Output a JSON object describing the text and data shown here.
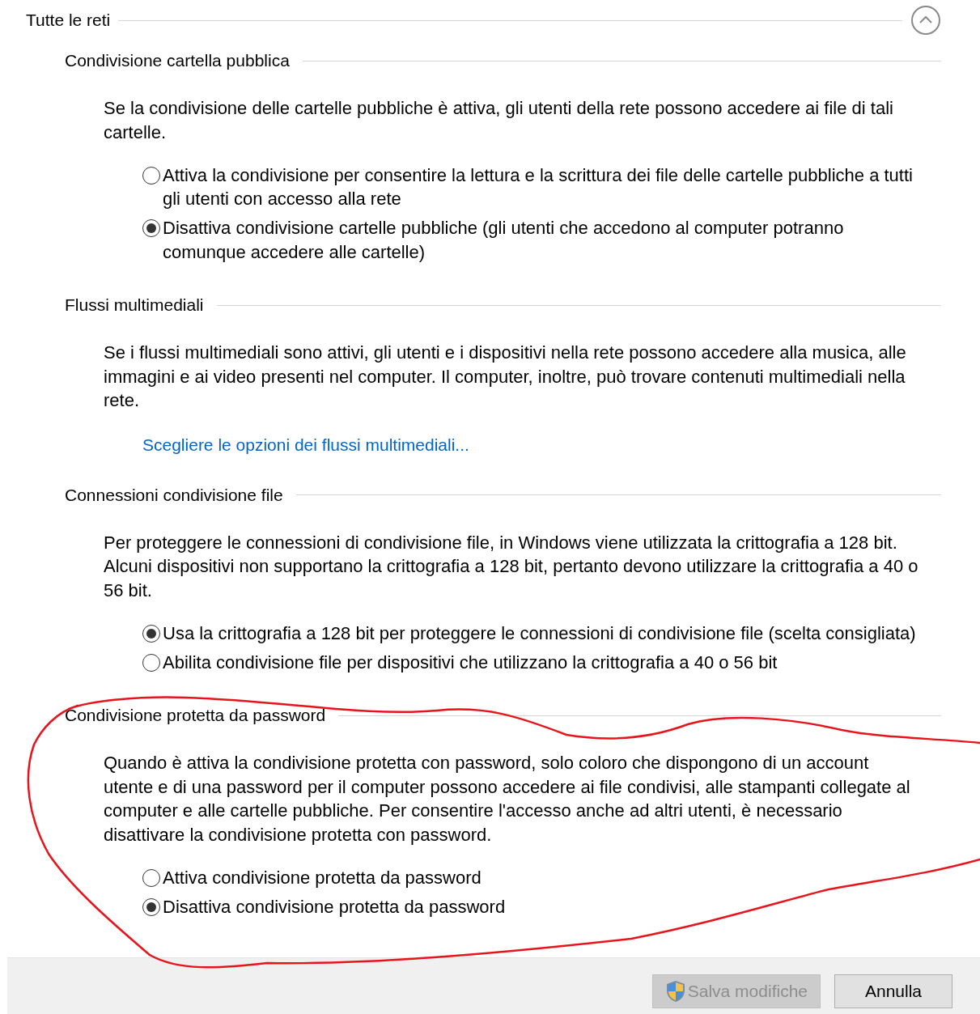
{
  "group": {
    "title": "Tutte le reti",
    "expanded": true
  },
  "sections": [
    {
      "title": "Condivisione cartella pubblica",
      "description": "Se la condivisione delle cartelle pubbliche è attiva, gli utenti della rete possono accedere ai file di tali cartelle.",
      "kind": "radios",
      "options": [
        {
          "label": "Attiva la condivisione per consentire la lettura e la scrittura dei file delle cartelle pubbliche a tutti gli utenti con accesso alla rete",
          "selected": false
        },
        {
          "label": "Disattiva condivisione cartelle pubbliche (gli utenti che accedono al computer potranno comunque accedere alle cartelle)",
          "selected": true
        }
      ]
    },
    {
      "title": "Flussi multimediali",
      "description": "Se i flussi multimediali sono attivi, gli utenti e i dispositivi nella rete possono accedere alla musica, alle immagini e ai video presenti nel computer. Il computer, inoltre, può trovare contenuti multimediali nella rete.",
      "kind": "link",
      "link": "Scegliere le opzioni dei flussi multimediali..."
    },
    {
      "title": "Connessioni condivisione file",
      "description": "Per proteggere le connessioni di condivisione file, in Windows viene utilizzata la crittografia a 128 bit. Alcuni dispositivi non supportano la crittografia a 128 bit, pertanto devono utilizzare la crittografia a 40 o 56 bit.",
      "kind": "radios",
      "options": [
        {
          "label": "Usa la crittografia a 128 bit per proteggere le connessioni di condivisione file (scelta consigliata)",
          "selected": true
        },
        {
          "label": "Abilita condivisione file per dispositivi che utilizzano la crittografia a 40 o 56 bit",
          "selected": false
        }
      ]
    },
    {
      "title": "Condivisione protetta da password",
      "description": "Quando è attiva la condivisione protetta con password, solo coloro che dispongono di un account utente e di una password per il computer possono accedere ai file condivisi, alle stampanti collegate al computer e alle cartelle pubbliche. Per consentire l'accesso anche ad altri utenti, è necessario disattivare la condivisione protetta con password.",
      "kind": "radios",
      "options": [
        {
          "label": "Attiva condivisione protetta da password",
          "selected": false
        },
        {
          "label": "Disattiva condivisione protetta da password",
          "selected": true
        }
      ]
    }
  ],
  "buttons": [
    {
      "label": "Salva modifiche",
      "disabled": true,
      "shield": true
    },
    {
      "label": "Annulla",
      "disabled": false,
      "shield": false
    }
  ]
}
